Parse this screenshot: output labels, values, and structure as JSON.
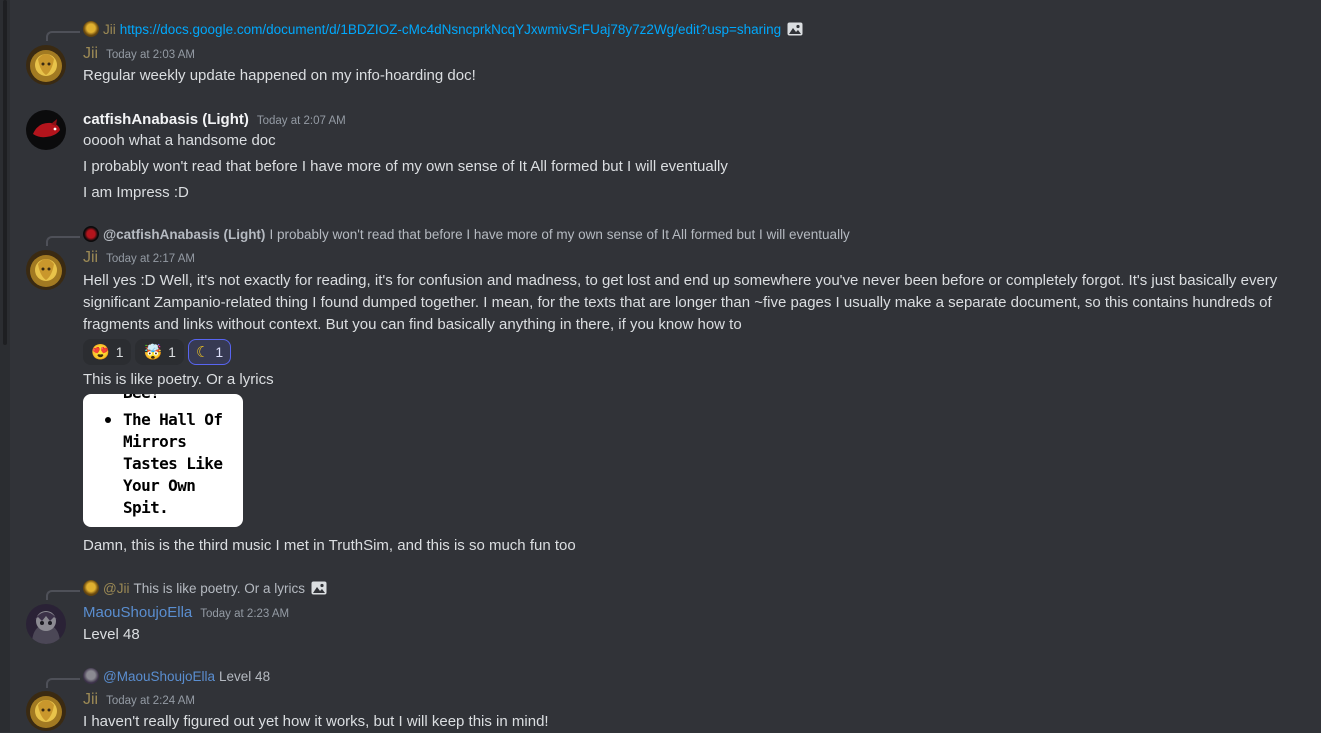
{
  "messages": {
    "m1": {
      "reply": {
        "name": "Jii",
        "text": "https://docs.google.com/document/d/1BDZIOZ-cMc4dNsncprkNcqYJxwmivSrFUaj78y7z2Wg/edit?usp=sharing"
      },
      "author": "Jii",
      "time": "Today at 2:03 AM",
      "lines": [
        "Regular weekly update happened on my info-hoarding doc!"
      ]
    },
    "m2": {
      "author": "catfishAnabasis (Light)",
      "time": "Today at 2:07 AM",
      "lines": [
        "ooooh what a handsome doc",
        "I probably won't read that before I have more of my own sense of It All formed but I will eventually",
        "I am Impress :D"
      ]
    },
    "m3": {
      "reply": {
        "name": "@catfishAnabasis (Light)",
        "text": "I probably won't read that before I have more of my own sense of It All formed but I will eventually"
      },
      "author": "Jii",
      "time": "Today at 2:17 AM",
      "body": "Hell yes :D Well, it's not exactly for reading, it's for confusion and madness, to get lost and end up somewhere you've never been before or completely forgot. It's just basically every significant Zampanio-related thing I found dumped together. I mean, for the texts that are longer than ~five pages I usually make a separate document, so this contains hundreds of fragments and links without context. But you can find basically anything in there, if you know how to",
      "reactions": [
        {
          "emoji": "😍",
          "count": "1",
          "active": false
        },
        {
          "emoji": "🤯",
          "count": "1",
          "active": false
        },
        {
          "emoji": "☾",
          "count": "1",
          "active": true
        }
      ],
      "line2": "This is like poetry. Or a lyrics",
      "image_text": [
        "Bee!",
        "The Hall Of",
        "Mirrors",
        "Tastes Like",
        "Your Own",
        "Spit."
      ],
      "line3": "Damn, this is the third music I met in TruthSim, and this is so much fun too"
    },
    "m4": {
      "reply": {
        "name": "@Jii",
        "text": "This is like poetry. Or a lyrics"
      },
      "author": "MaouShoujoElla",
      "time": "Today at 2:23 AM",
      "lines": [
        "Level 48"
      ]
    },
    "m5": {
      "reply": {
        "name": "@MaouShoujoElla",
        "text": "Level 48"
      },
      "author": "Jii",
      "time": "Today at 2:24 AM",
      "lines": [
        "I haven't really figured out yet how it works, but I will keep this in mind!"
      ]
    }
  },
  "colors": {
    "background": "#313338",
    "jii_name": "#9c8a55",
    "mao_name": "#5a8ed0",
    "link": "#00a8fc"
  }
}
